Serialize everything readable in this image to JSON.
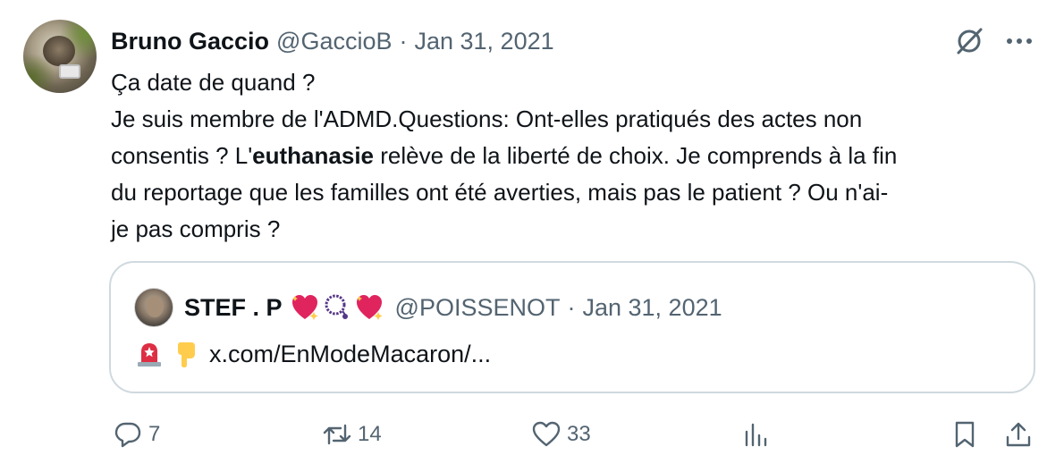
{
  "tweet": {
    "author_name": "Bruno Gaccio",
    "author_handle": "@GaccioB",
    "separator": "·",
    "date": "Jan 31, 2021",
    "lines": [
      "Ça date de quand ?",
      "Je suis membre de l'ADMD.Questions: Ont-elles pratiqués des actes non",
      "du reportage que les familles ont été averties, mais pas le patient ? Ou n'ai-",
      "je pas compris ?"
    ],
    "line3_before": "consentis ?  L'",
    "line3_bold": "euthanasie",
    "line3_after": " relève de la liberté de choix. Je comprends à la fin"
  },
  "quote": {
    "author_name": "STEF . P",
    "author_handle": "@POISSENOT",
    "separator": "·",
    "date": "Jan 31, 2021",
    "link_text": "x.com/EnModeMacaron/..."
  },
  "actions": {
    "replies": "7",
    "retweets": "14",
    "likes": "33"
  },
  "icons": {
    "reply": "reply-icon",
    "retweet": "retweet-icon",
    "like": "heart-icon",
    "views": "analytics-icon",
    "bookmark": "bookmark-icon",
    "share": "share-icon",
    "grok": "grok-icon",
    "more": "more-icon"
  },
  "colors": {
    "text": "#0f1419",
    "secondary": "#536471",
    "border": "#cfd9de"
  }
}
